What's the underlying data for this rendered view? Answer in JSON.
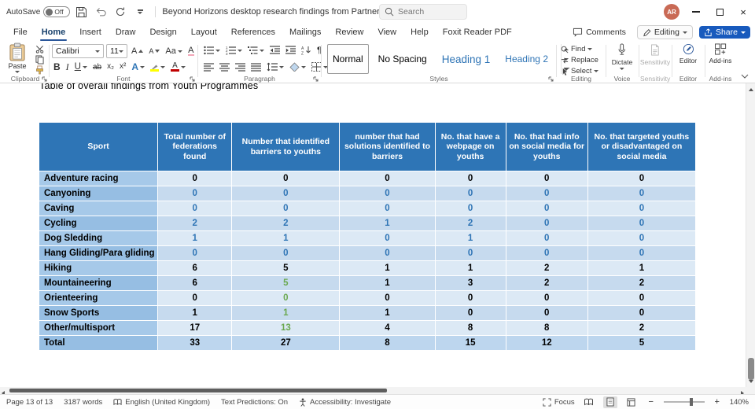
{
  "titlebar": {
    "autosave_label": "AutoSave",
    "autosave_state": "Off",
    "doc_title": "Beyond Horizons desktop research findings from Partner Countries report-...",
    "search_placeholder": "Search",
    "avatar_initials": "AR"
  },
  "tabs_row": {
    "tabs": [
      "File",
      "Home",
      "Insert",
      "Draw",
      "Design",
      "Layout",
      "References",
      "Mailings",
      "Review",
      "View",
      "Help",
      "Foxit Reader PDF"
    ],
    "active_tab": "Home",
    "comments_label": "Comments",
    "editing_label": "Editing",
    "share_label": "Share"
  },
  "ribbon": {
    "paste_label": "Paste",
    "font_name": "Calibri",
    "font_size": "11",
    "group_labels": {
      "clipboard": "Clipboard",
      "font": "Font",
      "paragraph": "Paragraph",
      "styles": "Styles",
      "editing": "Editing",
      "voice": "Voice",
      "sensitivity": "Sensitivity",
      "editor": "Editor",
      "addins": "Add-ins"
    },
    "style_gallery": [
      {
        "name": "Normal",
        "selected": true
      },
      {
        "name": "No Spacing",
        "selected": false
      },
      {
        "name": "Heading 1",
        "selected": false
      },
      {
        "name": "Heading 2",
        "selected": false
      }
    ],
    "editing_items": [
      "Find",
      "Replace",
      "Select"
    ],
    "dictate_label": "Dictate",
    "sensitivity_label": "Sensitivity",
    "editor_label": "Editor",
    "addins_label": "Add-ins"
  },
  "icons": {
    "close": "×",
    "bold": "B",
    "italic": "I",
    "underline": "U",
    "strikethrough": "ab",
    "subscript": "x₂",
    "superscript": "x²",
    "change_case": "Aa",
    "grow_font": "A",
    "shrink_font": "A",
    "clear_formatting": "A",
    "text_effects": "A",
    "highlight": "ab",
    "font_color": "A",
    "pilcrow": "¶",
    "minus": "−",
    "plus": "+"
  },
  "document": {
    "heading": "Table of overall findings from Youth Programmes",
    "table": {
      "columns": [
        "Sport",
        "Total number of federations found",
        "Number that identified barriers to youths",
        "number that had solutions identified to barriers",
        "No. that have a webpage on youths",
        "No. that had info on social media for youths",
        "No. that targeted youths or disadvantaged on social media"
      ],
      "rows": [
        {
          "sport": "Adventure racing",
          "values": [
            "0",
            "0",
            "0",
            "0",
            "0",
            "0"
          ],
          "num_color": "black"
        },
        {
          "sport": "Canyoning",
          "values": [
            "0",
            "0",
            "0",
            "0",
            "0",
            "0"
          ],
          "num_color": "blue"
        },
        {
          "sport": "Caving",
          "values": [
            "0",
            "0",
            "0",
            "0",
            "0",
            "0"
          ],
          "num_color": "blue"
        },
        {
          "sport": "Cycling",
          "values": [
            "2",
            "2",
            "1",
            "2",
            "0",
            "0"
          ],
          "num_color": "blue"
        },
        {
          "sport": "Dog Sledding",
          "values": [
            "1",
            "1",
            "0",
            "1",
            "0",
            "0"
          ],
          "num_color": "blue"
        },
        {
          "sport": "Hang Gliding/Para gliding",
          "values": [
            "0",
            "0",
            "0",
            "0",
            "0",
            "0"
          ],
          "num_color": "blue"
        },
        {
          "sport": "Hiking",
          "values": [
            "6",
            "5",
            "1",
            "1",
            "2",
            "1"
          ],
          "num_color": "black"
        },
        {
          "sport": "Mountaineering",
          "values": [
            "6",
            "5",
            "1",
            "3",
            "2",
            "2"
          ],
          "num_color": "black",
          "green_cols": [
            1
          ]
        },
        {
          "sport": "Orienteering",
          "values": [
            "0",
            "0",
            "0",
            "0",
            "0",
            "0"
          ],
          "num_color": "black",
          "green_cols": [
            1
          ]
        },
        {
          "sport": "Snow Sports",
          "values": [
            "1",
            "1",
            "1",
            "0",
            "0",
            "0"
          ],
          "num_color": "black",
          "green_cols": [
            1
          ]
        },
        {
          "sport": "Other/multisport",
          "values": [
            "17",
            "13",
            "4",
            "8",
            "8",
            "2"
          ],
          "num_color": "black",
          "green_cols": [
            1
          ]
        },
        {
          "sport": "Total",
          "values": [
            "33",
            "27",
            "8",
            "15",
            "12",
            "5"
          ],
          "num_color": "black",
          "is_total": true
        }
      ]
    }
  },
  "statusbar": {
    "page": "Page 13 of 13",
    "words": "3187 words",
    "language": "English (United Kingdom)",
    "predictions": "Text Predictions: On",
    "accessibility": "Accessibility: Investigate",
    "focus_label": "Focus",
    "zoom_level": "140%"
  },
  "colors": {
    "header_bg": "#2E75B6",
    "row_light": "#DCE9F5",
    "row_dark": "#C6DAEE",
    "sport_light": "#A6C9E9",
    "sport_dark": "#96BEE3",
    "total_bg": "#BDD6EE",
    "blue_text": "#2E74B5",
    "green_text": "#6AA84F",
    "share_bg": "#185ABD"
  }
}
